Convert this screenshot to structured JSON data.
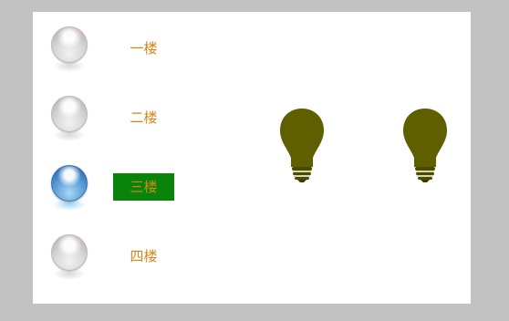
{
  "floors": [
    {
      "label": "一楼",
      "state": "off"
    },
    {
      "label": "二楼",
      "state": "off"
    },
    {
      "label": "三楼",
      "state": "on"
    },
    {
      "label": "四楼",
      "state": "off"
    }
  ],
  "bulbs": [
    {
      "name": "bulb-1",
      "state": "off"
    },
    {
      "name": "bulb-2",
      "state": "off"
    }
  ],
  "colors": {
    "background": "#c2c2c2",
    "panel": "#ffffff",
    "label_text": "#d4861c",
    "active_label_bg": "#098309",
    "bulb_off": "#5f5f00",
    "orb_on": "#5ea0d6",
    "orb_off": "#d8d8d8"
  },
  "icons": {
    "switch_on": "blue-glass-orb",
    "switch_off": "gray-glass-orb",
    "light": "light-bulb"
  }
}
